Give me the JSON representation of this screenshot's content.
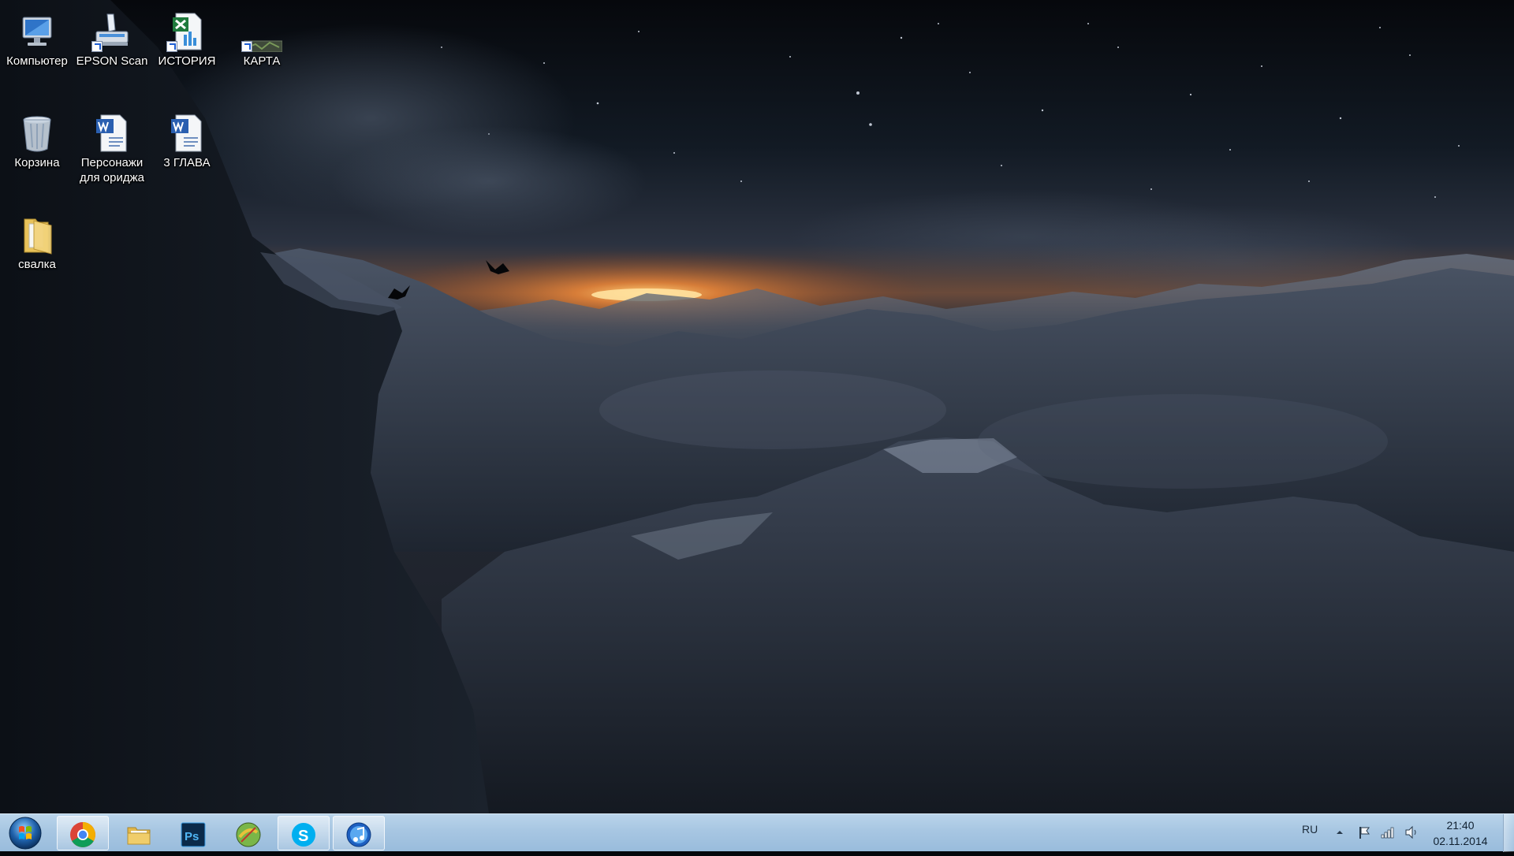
{
  "desktop": {
    "icons": {
      "computer": {
        "label": "Компьютер"
      },
      "epson_scan": {
        "label": "EPSON Scan"
      },
      "history": {
        "label": "ИСТОРИЯ"
      },
      "map": {
        "label": "КАРТА"
      },
      "recycle_bin": {
        "label": "Корзина"
      },
      "characters": {
        "label": "Персонажи для ориджа"
      },
      "chapter3": {
        "label": "3 ГЛАВА"
      },
      "svalka": {
        "label": "свалка"
      }
    }
  },
  "taskbar": {
    "pinned": [
      "chrome-icon",
      "explorer-icon",
      "photoshop-icon",
      "game-icon",
      "skype-icon",
      "itunes-icon"
    ],
    "tray": {
      "language": "RU",
      "time": "21:40",
      "date": "02.11.2014"
    }
  },
  "colors": {
    "taskbar": "#a7c6e2",
    "sky_dark": "#0b0f16",
    "sunset": "#f08a3c"
  }
}
